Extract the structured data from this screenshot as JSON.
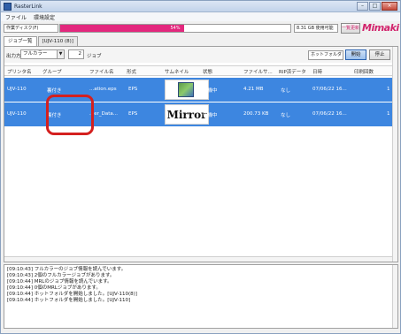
{
  "window": {
    "title": "RasterLink"
  },
  "window_buttons": {
    "minimize": "–",
    "maximize": "□",
    "close": "×"
  },
  "menu": [
    "ファイル",
    "環境設定"
  ],
  "disk": {
    "label": "作業ディスク(F)",
    "percent": "54%",
    "fill_fraction": 0.54,
    "free": "8.31 GB 使用可能"
  },
  "update_button": "一覧更新",
  "brand": "Mimaki",
  "tabs": [
    "ジョブ一覧",
    "[UJV-110 (8)]"
  ],
  "toolbar": {
    "output_label": "出力方法",
    "output_value": "フルカラー",
    "count": "2",
    "count_unit": "ジョブ",
    "hotfolder": "ホットフォルダ",
    "start": "開始",
    "stop": "停止"
  },
  "columns": [
    "プリンタ名",
    "グループ",
    "ファイル名",
    "形式",
    "サムネイル",
    "状態",
    "ファイルサ...",
    "RIP済データ",
    "日時",
    "印刷回数"
  ],
  "rows": [
    {
      "printer": "UJV-110",
      "group": "裏付き",
      "file": "...ation.eps",
      "format": "EPS",
      "thumb": "",
      "status": "待機中",
      "size": "4.21 MB",
      "rip": "なし",
      "date": "07/06/22 16...",
      "count": "1"
    },
    {
      "printer": "UJV-110",
      "group": "裏付き",
      "file": "...er_Data...",
      "format": "EPS",
      "thumb": "Mirror",
      "status": "待機中",
      "size": "200.73 KB",
      "rip": "なし",
      "date": "07/06/22 16...",
      "count": "1"
    }
  ],
  "log": [
    "[09:10:43] フルカラーのジョブ情報を読んでいます。",
    "[09:10:43] 2個のフルカラージョブがあります。",
    "[09:10:44] MRLのジョブ情報を読んでいます。",
    "[09:10:44] 0個のMRLジョブがあります。",
    "[09:10:44] ホットフォルダを開始しました。[UJV-110(8)]",
    "[09:10:44] ホットフォルダを開始しました。[UJV-110]"
  ],
  "colors": {
    "accent": "#3d86e0",
    "disk_fill": "#e3277d",
    "brand": "#d2236c",
    "highlight": "#d4201f"
  }
}
